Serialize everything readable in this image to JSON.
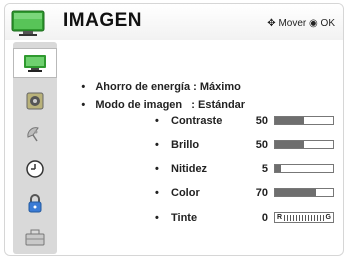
{
  "header": {
    "title": "IMAGEN",
    "hint_move": "Mover",
    "hint_ok": "OK"
  },
  "sidebar": {
    "items": [
      {
        "icon": "picture-tv-icon",
        "active": true
      },
      {
        "icon": "audio-speaker-icon",
        "active": false
      },
      {
        "icon": "satellite-dish-icon",
        "active": false
      },
      {
        "icon": "clock-icon",
        "active": false
      },
      {
        "icon": "lock-icon",
        "active": false
      },
      {
        "icon": "toolbox-icon",
        "active": false
      }
    ]
  },
  "main": {
    "energy_label": "Ahorro de energía : Máximo",
    "mode_label": "Modo de imagen   : Estándar",
    "settings": [
      {
        "name": "Contraste",
        "value": "50",
        "level": 0.5
      },
      {
        "name": "Brillo",
        "value": "50",
        "level": 0.5
      },
      {
        "name": "Nitidez",
        "value": "5",
        "level": 0.1
      },
      {
        "name": "Color",
        "value": "70",
        "level": 0.7
      }
    ],
    "tint": {
      "name": "Tinte",
      "value": "0",
      "left_letter": "R",
      "right_letter": "G"
    }
  },
  "colors": {
    "accent_green": "#3aa83a",
    "bar_fill": "#6e6e6e",
    "sidebar_bg": "#d9d9d9"
  }
}
